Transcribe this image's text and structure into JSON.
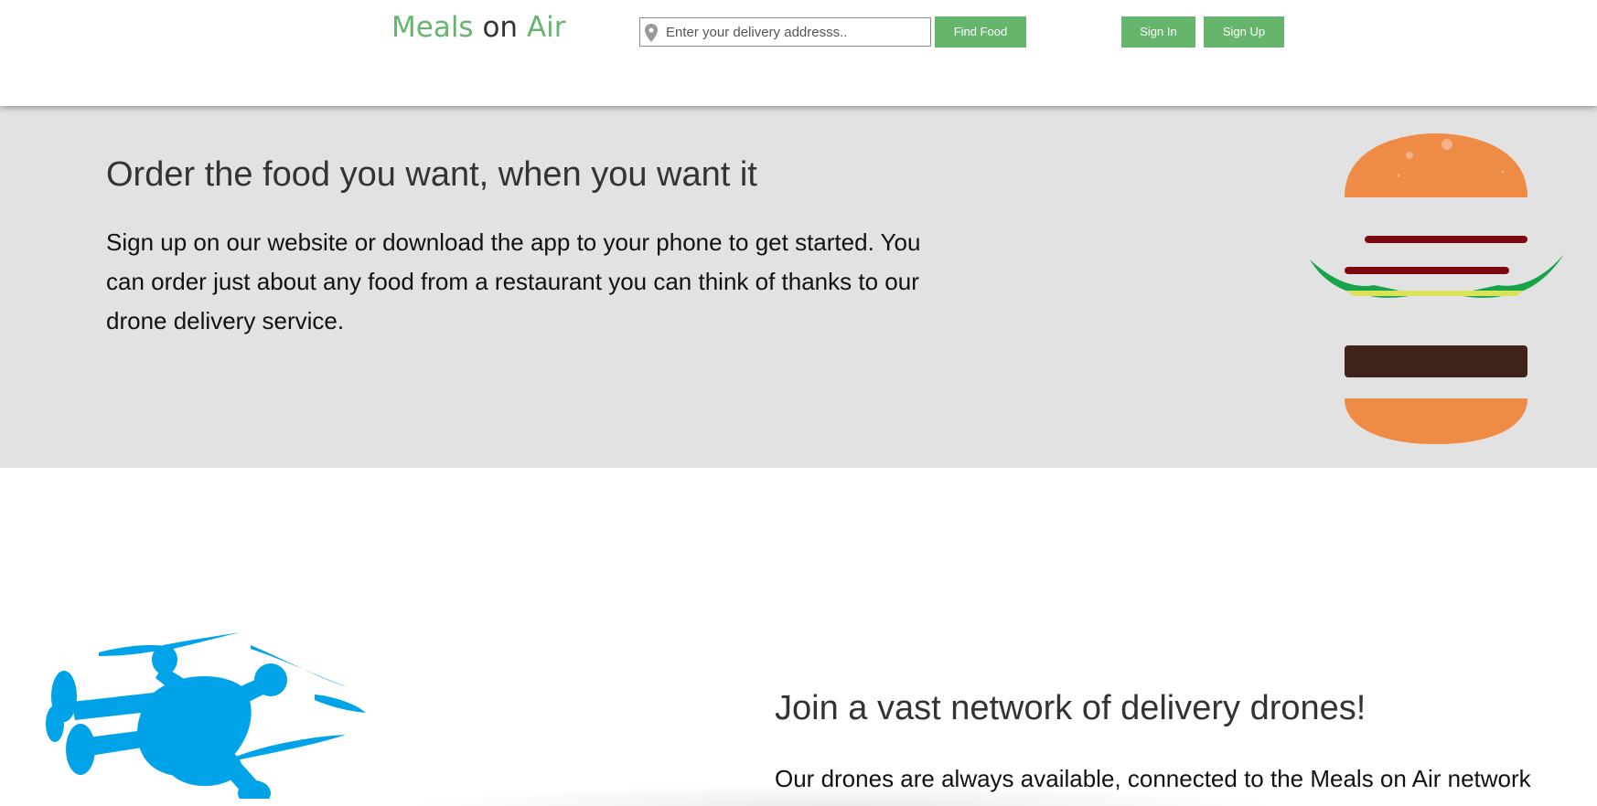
{
  "header": {
    "logo": {
      "part1": "Meals",
      "part2": "on",
      "part3": "Air"
    },
    "search": {
      "placeholder": "Enter your delivery addresss..",
      "value": ""
    },
    "find_food_label": "Find Food",
    "sign_in_label": "Sign In",
    "sign_up_label": "Sign Up"
  },
  "hero": {
    "title": "Order the food you want, when you want it",
    "text": "Sign up on our website or download the app to your phone to get started. You can order just about any food from a restaurant you can think of thanks to our drone delivery service."
  },
  "network": {
    "title": "Join a vast network of delivery drones!",
    "text": "Our drones are always available, connected to the Meals on Air network"
  },
  "colors": {
    "brand_green": "#66b56c",
    "hero_background": "#e2e2e2",
    "drone_blue": "#00a2e8",
    "bun_orange": "#ee8b44"
  },
  "icons": {
    "search": "map-pin-icon",
    "hero": "burger-illustration",
    "network": "drone-illustration"
  }
}
